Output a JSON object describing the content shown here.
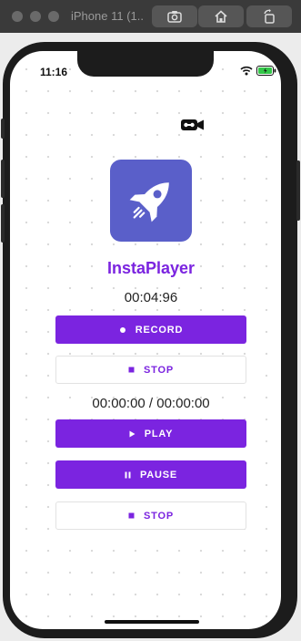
{
  "window": {
    "title": "iPhone 11 (1..."
  },
  "status_bar": {
    "time": "11:16"
  },
  "app": {
    "title": "InstaPlayer",
    "record_timer": "00:04:96",
    "playback_timer": "00:00:00 / 00:00:00"
  },
  "buttons": {
    "record": "RECORD",
    "stop_record": "STOP",
    "play": "PLAY",
    "pause": "PAUSE",
    "stop_play": "STOP"
  },
  "colors": {
    "accent": "#7b24e0",
    "icon_bg": "#5a5fc9"
  },
  "icons": {
    "toolbar": [
      "screenshot-icon",
      "home-icon",
      "rotate-icon"
    ],
    "status": [
      "wifi-icon",
      "battery-icon"
    ],
    "app": [
      "rocket-icon",
      "video-camera-icon"
    ]
  }
}
